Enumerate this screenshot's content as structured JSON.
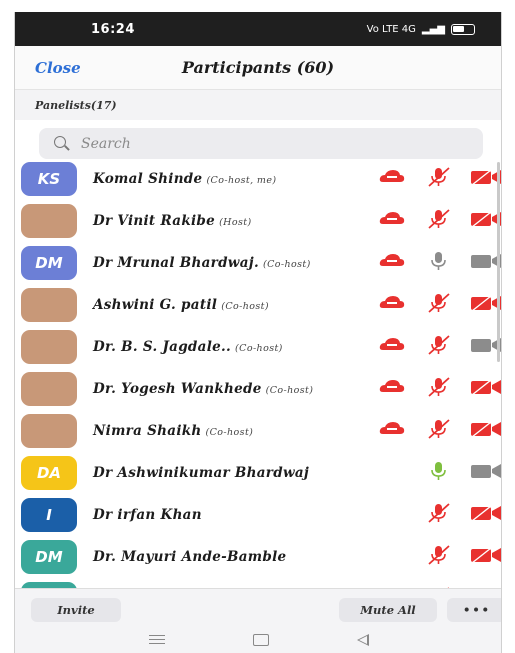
{
  "status_bar": {
    "time": "16:24",
    "signal_text": "Vo LTE 4G"
  },
  "header": {
    "close_label": "Close",
    "title": "Participants (60)"
  },
  "section": {
    "label": "Panelists(17)"
  },
  "search": {
    "placeholder": "Search"
  },
  "colors": {
    "accent_blue": "#2d6fd6",
    "icon_red": "#e8312f",
    "icon_gray": "#8c8c8c",
    "icon_green": "#7fbf3f"
  },
  "participants": [
    {
      "avatar_initials": "KS",
      "avatar_color": "#6c7fd6",
      "name": "Komal Shinde",
      "role": "(Co-host, me)",
      "cloud": true,
      "mic": "muted",
      "cam": "off"
    },
    {
      "avatar_initials": "",
      "avatar_photo": "photo-building",
      "name": "Dr Vinit Rakibe",
      "role": "(Host)",
      "cloud": true,
      "mic": "muted",
      "cam": "off"
    },
    {
      "avatar_initials": "DM",
      "avatar_color": "#6c7fd6",
      "name": "Dr Mrunal Bhardwaj.",
      "role": "(Co-host)",
      "cloud": true,
      "mic": "on",
      "cam": "gray"
    },
    {
      "avatar_initials": "",
      "avatar_photo": "photo-f1",
      "name": "Ashwini G. patil",
      "role": "(Co-host)",
      "cloud": true,
      "mic": "muted",
      "cam": "off"
    },
    {
      "avatar_initials": "",
      "avatar_photo": "photo-m1",
      "name": "Dr. B. S. Jagdale..",
      "role": "(Co-host)",
      "cloud": true,
      "mic": "muted",
      "cam": "gray"
    },
    {
      "avatar_initials": "",
      "avatar_photo": "photo-m2",
      "name": "Dr. Yogesh Wankhede",
      "role": "(Co-host)",
      "cloud": true,
      "mic": "muted",
      "cam": "off"
    },
    {
      "avatar_initials": "",
      "avatar_photo": "photo-f2",
      "name": "Nimra Shaikh",
      "role": "(Co-host)",
      "cloud": true,
      "mic": "muted",
      "cam": "off"
    },
    {
      "avatar_initials": "DA",
      "avatar_color": "#f5c518",
      "name": "Dr Ashwinikumar Bhardwaj",
      "role": "",
      "cloud": false,
      "mic": "active",
      "cam": "gray"
    },
    {
      "avatar_initials": "I",
      "avatar_color": "#1b5fa8",
      "name": "Dr irfan Khan",
      "role": "",
      "cloud": false,
      "mic": "muted",
      "cam": "off"
    },
    {
      "avatar_initials": "DM",
      "avatar_color": "#3aa89a",
      "name": "Dr. Mayuri Ande-Bamble",
      "role": "",
      "cloud": false,
      "mic": "muted",
      "cam": "off"
    },
    {
      "avatar_initials": "",
      "avatar_color": "#3aa89a",
      "name": "",
      "role": "",
      "cloud": false,
      "mic": "muted",
      "cam": "none"
    }
  ],
  "footer": {
    "invite_label": "Invite",
    "mute_all_label": "Mute All",
    "more_label": "•••"
  }
}
